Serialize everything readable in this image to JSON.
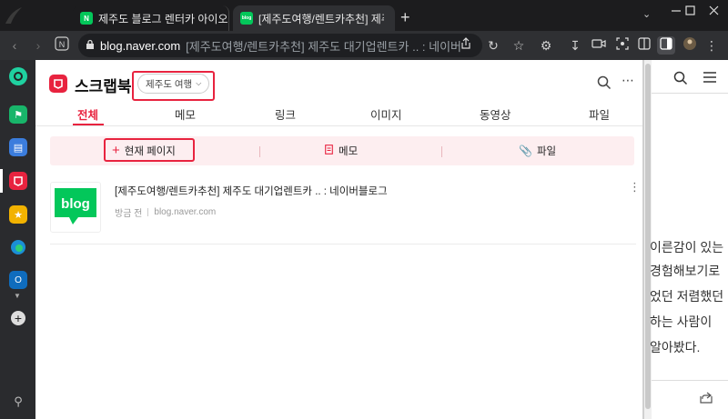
{
  "browser": {
    "tabs": [
      {
        "favicon_text": "N",
        "title": "제주도 블로그 렌터카 아이오닉",
        "favicon_color": "#03c75a"
      },
      {
        "favicon_text": "blog",
        "title": "[제주도여행/렌트카추천] 제주도",
        "favicon_color": "#03c75a"
      }
    ],
    "url_domain": "blog.naver.com",
    "url_title": "[제주도여행/렌트카추천] 제주도 대기업렌트카 .. : 네이버",
    "window_controls": [
      "minimize",
      "maximize",
      "close"
    ]
  },
  "scrapbook": {
    "title": "스크랩북",
    "folder_dropdown": "제주도 여행",
    "nav_tabs": [
      "전체",
      "메모",
      "링크",
      "이미지",
      "동영상",
      "파일"
    ],
    "active_tab": "전체",
    "add_actions": {
      "current_page": "현재 페이지",
      "memo": "메모",
      "file": "파일"
    },
    "items": [
      {
        "thumb_text": "blog",
        "title": "[제주도여행/렌트카추천] 제주도 대기업렌트카 .. : 네이버블로그",
        "time": "방금 전",
        "source": "blog.naver.com"
      }
    ]
  },
  "background_page": {
    "lines": [
      "이른감이 있는",
      "경험해보기로",
      "었던 저렴했던",
      "하는 사람이",
      "알아봤다."
    ]
  },
  "colors": {
    "accent": "#e8233f",
    "naver_green": "#03c75a"
  }
}
